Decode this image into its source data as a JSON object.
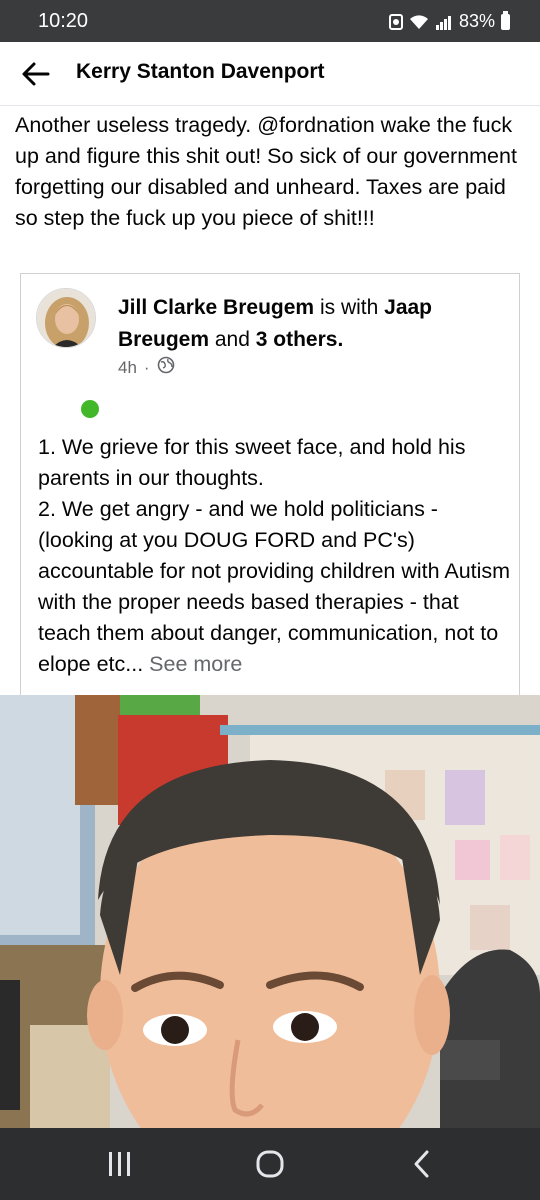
{
  "status_bar": {
    "time": "10:20",
    "battery": "83%"
  },
  "header": {
    "title": "Kerry Stanton Davenport"
  },
  "post": {
    "text": "Another useless tragedy. @fordnation wake the fuck up and figure this shit out!  So sick of our government forgetting our disabled and unheard. Taxes are paid so step the fuck up you piece of shit!!!"
  },
  "shared_post": {
    "author": "Jill Clarke Breugem",
    "with_text": "is with",
    "tagged": "Jaap Breugem",
    "and_text": "and",
    "others": "3 others.",
    "time": "4h",
    "separator": "·",
    "paragraph_1": "1. We grieve for this sweet face, and hold his parents in our thoughts.",
    "paragraph_2": "2. We get angry - and we hold politicians  - (looking at you DOUG FORD and PC's) accountable for not providing children with Autism with the proper needs based therapies   - that teach them about  danger, communication, not to elope etc...",
    "see_more": "See more"
  },
  "icons": {
    "back": "arrow-left-icon",
    "privacy": "globe-icon",
    "nav_recents": "recent-apps-icon",
    "nav_home": "home-icon",
    "nav_back": "chevron-left-icon"
  },
  "colors": {
    "status_bar": "#3a3b3c",
    "nav_bar": "#2d2e30",
    "presence": "#42b72a",
    "secondary_text": "#65676b"
  }
}
